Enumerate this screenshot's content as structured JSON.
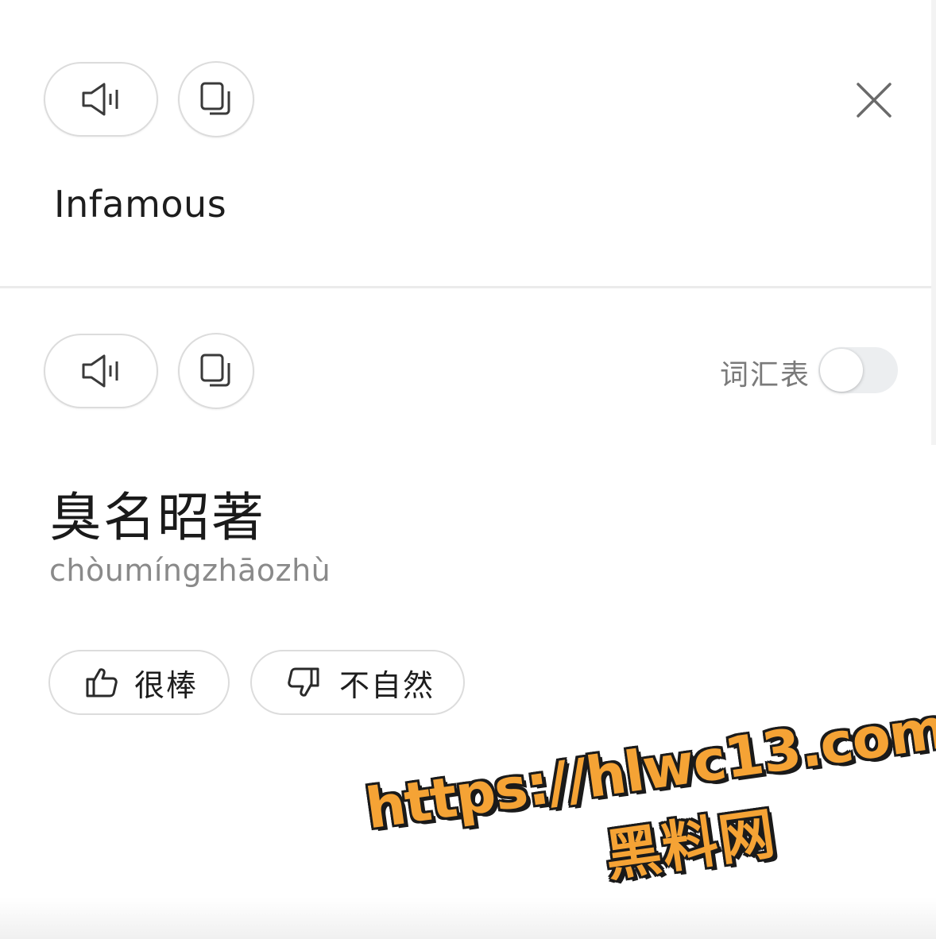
{
  "source": {
    "text": "Infamous",
    "icons": {
      "speak": "speaker-icon",
      "copy": "copy-icon",
      "close": "close-icon"
    }
  },
  "target": {
    "text": "臭名昭著",
    "pinyin": "chòumíngzhāozhù",
    "vocab_label": "词汇表",
    "vocab_enabled": false,
    "icons": {
      "speak": "speaker-icon",
      "copy": "copy-icon"
    }
  },
  "feedback": {
    "good_label": "很棒",
    "bad_label": "不自然",
    "icons": {
      "good": "thumbs-up-icon",
      "bad": "thumbs-down-icon"
    }
  },
  "watermark": {
    "url": "https://hlwc13.com",
    "name": "黑料网"
  },
  "colors": {
    "text_primary": "#1a1a1a",
    "text_secondary": "#8a8a8a",
    "border": "#dcdcdc",
    "toggle_off": "#eceef0",
    "watermark_fill": "#f5a335"
  }
}
